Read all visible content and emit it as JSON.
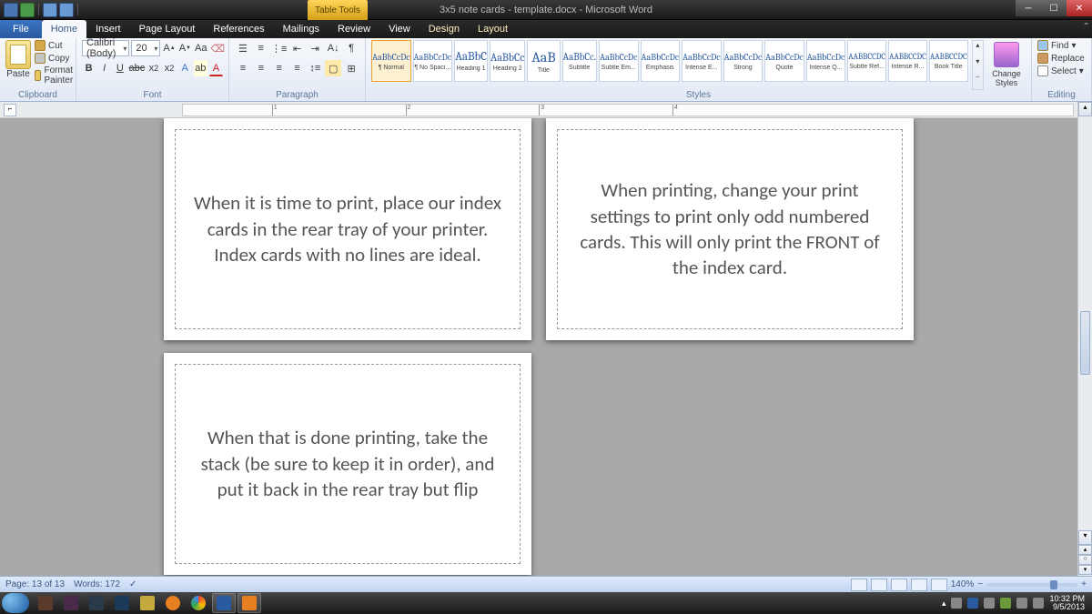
{
  "window": {
    "table_tools": "Table Tools",
    "title": "3x5 note cards - template.docx - Microsoft Word"
  },
  "tabs": {
    "file": "File",
    "list": [
      "Home",
      "Insert",
      "Page Layout",
      "References",
      "Mailings",
      "Review",
      "View",
      "Design",
      "Layout"
    ],
    "active": "Home"
  },
  "clipboard": {
    "group": "Clipboard",
    "paste": "Paste",
    "cut": "Cut",
    "copy": "Copy",
    "format_painter": "Format Painter"
  },
  "font": {
    "group": "Font",
    "name": "Calibri (Body)",
    "size": "20"
  },
  "paragraph": {
    "group": "Paragraph"
  },
  "styles": {
    "group": "Styles",
    "change_styles": "Change Styles",
    "items": [
      {
        "preview": "AaBbCcDc",
        "name": "¶ Normal",
        "sel": true
      },
      {
        "preview": "AaBbCcDc",
        "name": "¶ No Spaci..."
      },
      {
        "preview": "AaBbC",
        "name": "Heading 1"
      },
      {
        "preview": "AaBbCc",
        "name": "Heading 2"
      },
      {
        "preview": "AaB",
        "name": "Title"
      },
      {
        "preview": "AaBbCc.",
        "name": "Subtitle"
      },
      {
        "preview": "AaBbCcDc",
        "name": "Subtle Em..."
      },
      {
        "preview": "AaBbCcDc",
        "name": "Emphasis"
      },
      {
        "preview": "AaBbCcDc",
        "name": "Intense E..."
      },
      {
        "preview": "AaBbCcDc",
        "name": "Strong"
      },
      {
        "preview": "AaBbCcDc",
        "name": "Quote"
      },
      {
        "preview": "AaBbCcDc",
        "name": "Intense Q..."
      },
      {
        "preview": "AABBCCDC",
        "name": "Subtle Ref..."
      },
      {
        "preview": "AABBCCDC",
        "name": "Intense R..."
      },
      {
        "preview": "AABBCCDC",
        "name": "Book Title"
      }
    ]
  },
  "editing": {
    "group": "Editing",
    "find": "Find",
    "replace": "Replace",
    "select": "Select"
  },
  "cards": {
    "c1": "When it is time to print, place our index cards in the rear tray of your printer.  Index cards with no lines are ideal.",
    "c2": "When printing, change your print settings to print only odd numbered cards.  This will only print the FRONT of the index card.",
    "c3": "When that is done printing, take the stack (be sure to keep it in order), and put it back in the rear tray but flip"
  },
  "status": {
    "page": "Page: 13 of 13",
    "words": "Words: 172",
    "zoom": "140%"
  },
  "system": {
    "time": "10:32 PM",
    "date": "9/5/2013"
  }
}
